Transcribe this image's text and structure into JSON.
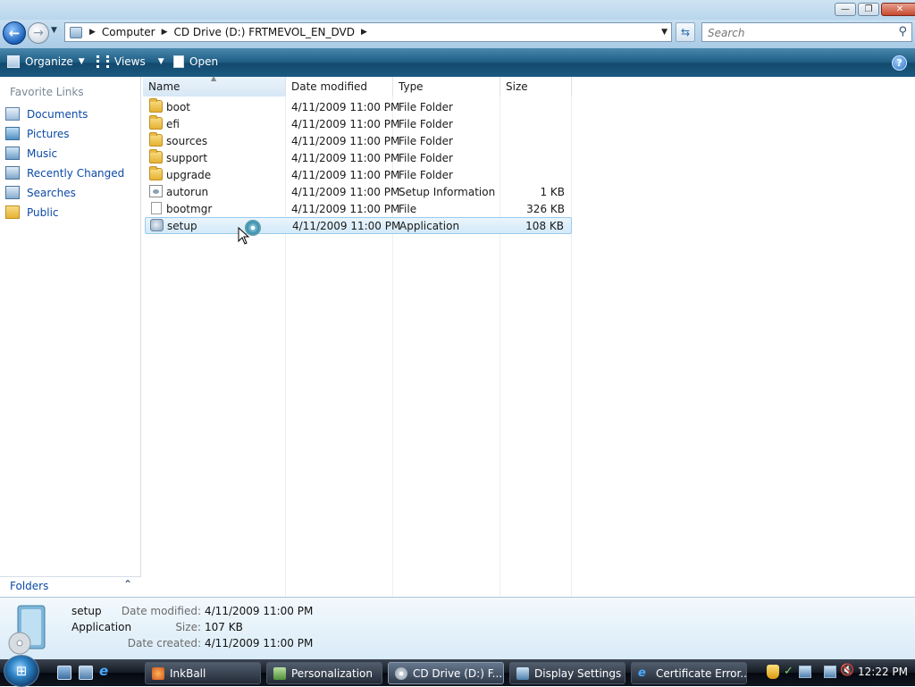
{
  "window": {
    "minimize_glyph": "—",
    "maximize_glyph": "❐",
    "close_glyph": "✕"
  },
  "nav": {
    "back_glyph": "←",
    "forward_glyph": "→",
    "breadcrumb": [
      "Computer",
      "CD Drive (D:) FRTMEVOL_EN_DVD"
    ],
    "search_placeholder": "Search"
  },
  "toolbar": {
    "organize_label": "Organize",
    "views_label": "Views",
    "open_label": "Open",
    "help_glyph": "?"
  },
  "sidebar": {
    "title": "Favorite Links",
    "items": [
      {
        "label": "Documents",
        "icon": "documents-icon"
      },
      {
        "label": "Pictures",
        "icon": "pictures-icon"
      },
      {
        "label": "Music",
        "icon": "music-icon"
      },
      {
        "label": "Recently Changed",
        "icon": "recently-changed-icon"
      },
      {
        "label": "Searches",
        "icon": "searches-icon"
      },
      {
        "label": "Public",
        "icon": "public-folder-icon"
      }
    ],
    "folders_label": "Folders"
  },
  "columns": {
    "name": "Name",
    "date": "Date modified",
    "type": "Type",
    "size": "Size"
  },
  "files": [
    {
      "name": "boot",
      "date": "4/11/2009 11:00 PM",
      "type": "File Folder",
      "size": "",
      "icon": "folder-icon"
    },
    {
      "name": "efi",
      "date": "4/11/2009 11:00 PM",
      "type": "File Folder",
      "size": "",
      "icon": "folder-icon"
    },
    {
      "name": "sources",
      "date": "4/11/2009 11:00 PM",
      "type": "File Folder",
      "size": "",
      "icon": "folder-icon"
    },
    {
      "name": "support",
      "date": "4/11/2009 11:00 PM",
      "type": "File Folder",
      "size": "",
      "icon": "folder-icon"
    },
    {
      "name": "upgrade",
      "date": "4/11/2009 11:00 PM",
      "type": "File Folder",
      "size": "",
      "icon": "folder-icon"
    },
    {
      "name": "autorun",
      "date": "4/11/2009 11:00 PM",
      "type": "Setup Information",
      "size": "1 KB",
      "icon": "setup-info-icon"
    },
    {
      "name": "bootmgr",
      "date": "4/11/2009 11:00 PM",
      "type": "File",
      "size": "326 KB",
      "icon": "file-icon"
    },
    {
      "name": "setup",
      "date": "4/11/2009 11:00 PM",
      "type": "Application",
      "size": "108 KB",
      "icon": "application-icon",
      "selected": true
    }
  ],
  "details": {
    "name": "setup",
    "kind": "Application",
    "modified_label": "Date modified:",
    "modified_value": "4/11/2009 11:00 PM",
    "size_label": "Size:",
    "size_value": "107 KB",
    "created_label": "Date created:",
    "created_value": "4/11/2009 11:00 PM"
  },
  "taskbar": {
    "tasks": [
      {
        "label": "InkBall",
        "active": false
      },
      {
        "label": "Personalization",
        "active": false
      },
      {
        "label": "CD Drive (D:) F...",
        "active": true
      },
      {
        "label": "Display Settings",
        "active": false
      },
      {
        "label": "Certificate Error...",
        "active": false
      }
    ],
    "clock": "12:22 PM"
  },
  "colors": {
    "link": "#0c4aa6",
    "command_bar": "#1d5c83",
    "selection": "#d3e9f9"
  }
}
